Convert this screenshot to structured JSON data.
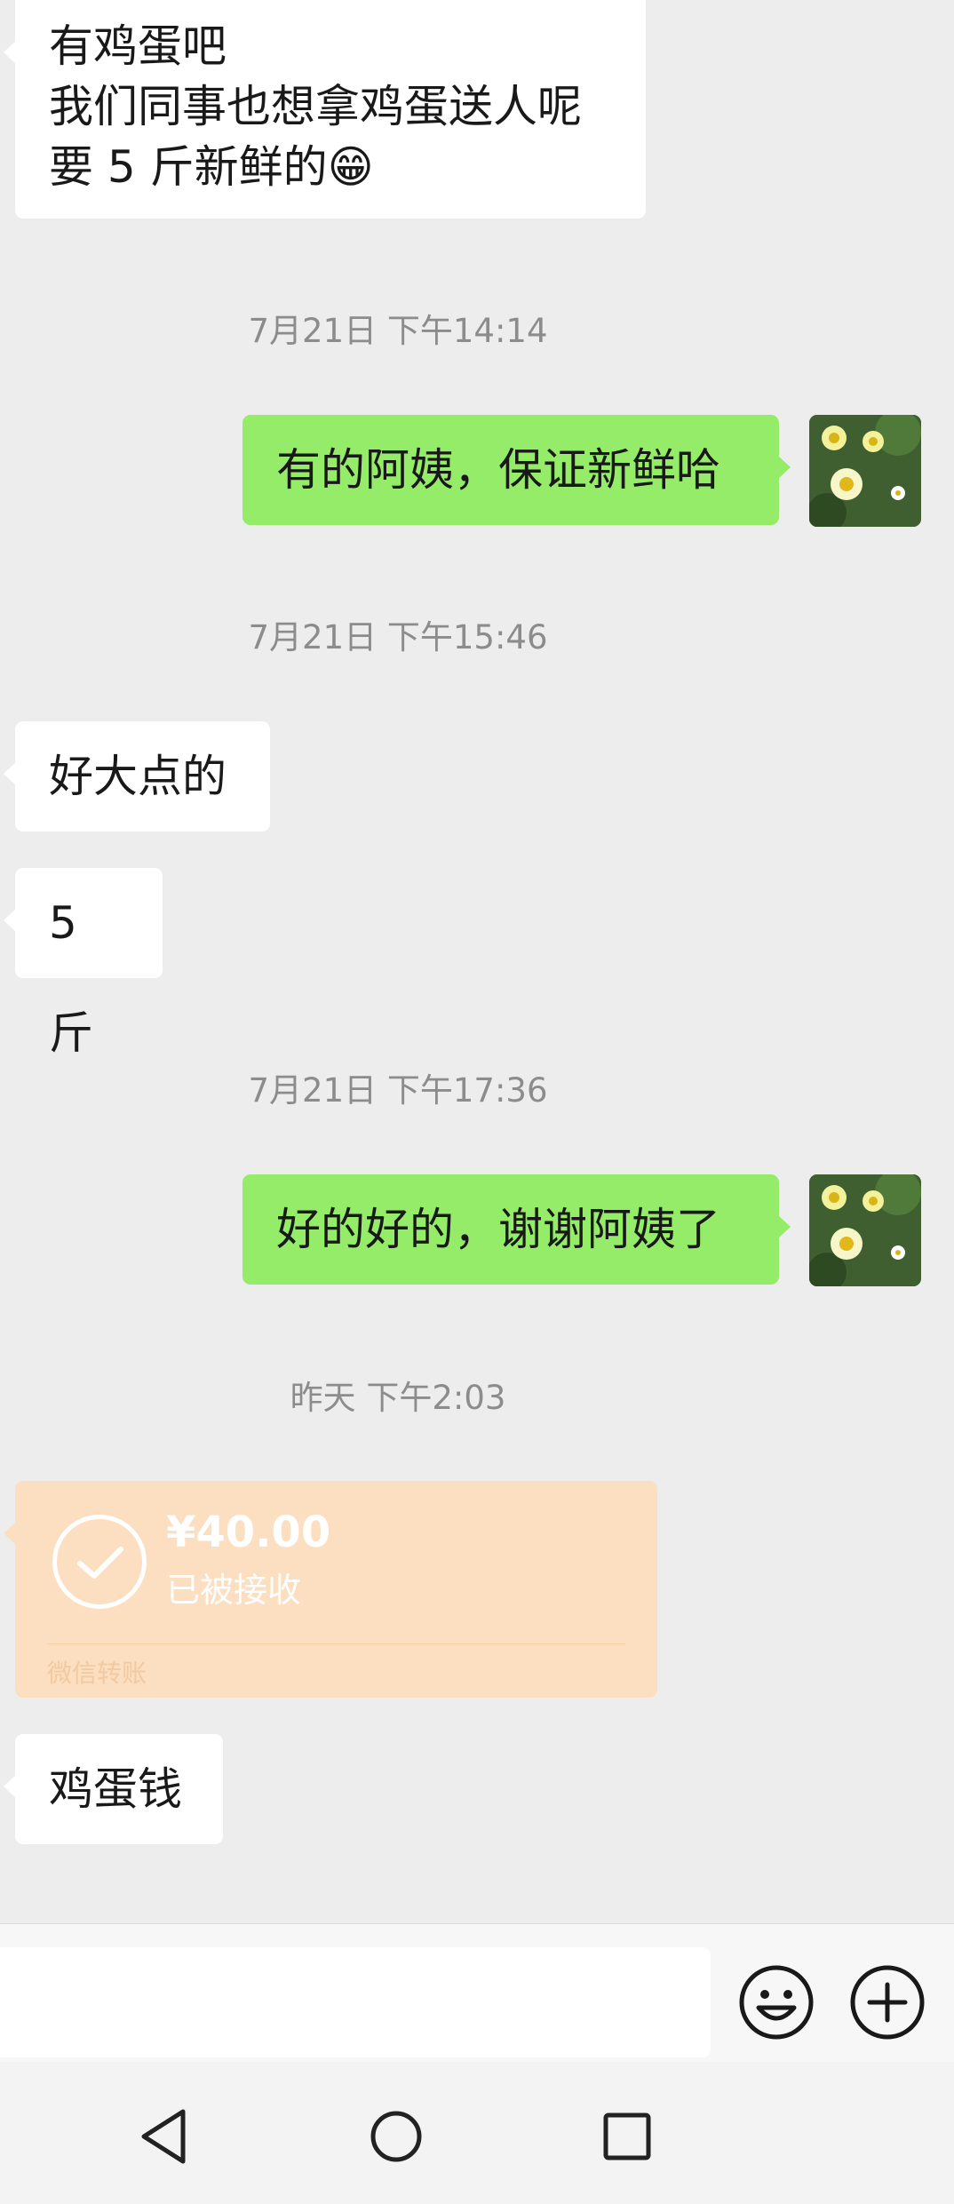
{
  "messages": [
    {
      "lines": [
        "有鸡蛋吧",
        "我们同事也想拿鸡蛋送人呢",
        "要 5 斤新鲜的😁"
      ]
    },
    {
      "time": "7月21日 下午14:14"
    },
    {
      "text": "有的阿姨，保证新鲜哈"
    },
    {
      "time": "7月21日 下午15:46"
    },
    {
      "text": "好大点的"
    },
    {
      "text": "5 斤"
    },
    {
      "time": "7月21日 下午17:36"
    },
    {
      "text": "好的好的，谢谢阿姨了"
    },
    {
      "time": "昨天 下午2:03"
    },
    {
      "text": "鸡蛋钱"
    }
  ],
  "transfer": {
    "amount": "¥40.00",
    "status": "已被接收",
    "label": "微信转账"
  },
  "input": {
    "value": "",
    "emoji_icon": "smiley-icon",
    "plus_icon": "plus-circle-icon"
  },
  "navigation": {
    "back_icon": "triangle-back-icon",
    "home_icon": "circle-home-icon",
    "recents_icon": "square-recents-icon"
  },
  "colors": {
    "sent_bubble": "#95ec69",
    "received_bubble": "#ffffff",
    "transfer_card": "#fbdfc0",
    "background": "#ededed"
  }
}
